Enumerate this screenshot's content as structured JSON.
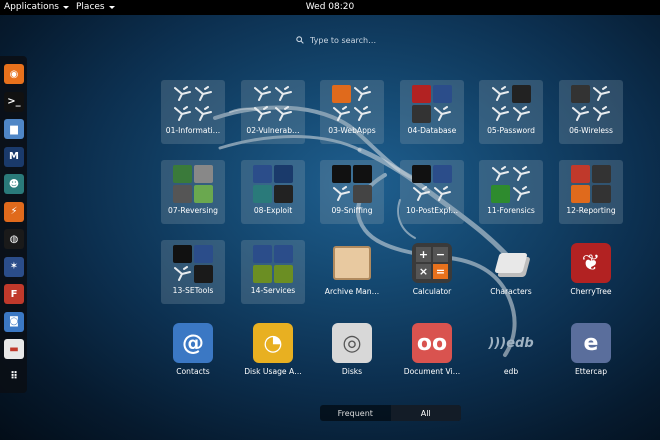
{
  "topbar": {
    "applications": "Applications",
    "places": "Places",
    "clock": "Wed 08:20"
  },
  "search": {
    "placeholder": "Type to search…"
  },
  "dock": [
    {
      "name": "firefox",
      "glyph": "◉",
      "bg": "#e8711c"
    },
    {
      "name": "terminal",
      "glyph": ">_",
      "bg": "#111111"
    },
    {
      "name": "files",
      "glyph": "▆",
      "bg": "#4f86c6"
    },
    {
      "name": "metasploit",
      "glyph": "M",
      "bg": "#1a3a6b"
    },
    {
      "name": "armitage",
      "glyph": "☻",
      "bg": "#2a7a7a"
    },
    {
      "name": "burpsuite",
      "glyph": "⚡",
      "bg": "#e06a1c"
    },
    {
      "name": "maltego",
      "glyph": "◍",
      "bg": "#1a1a1a"
    },
    {
      "name": "beef",
      "glyph": "✶",
      "bg": "#2b4d8a"
    },
    {
      "name": "faraday",
      "glyph": "F",
      "bg": "#c0392b"
    },
    {
      "name": "screenshot",
      "glyph": "◙",
      "bg": "#3b78c4"
    },
    {
      "name": "toggle-app",
      "glyph": "▬",
      "bg": "#e8e8e8"
    },
    {
      "name": "show-apps",
      "glyph": "⠿",
      "bg": "transparent"
    }
  ],
  "folders": [
    {
      "label": "01-Informati…",
      "minis": [
        "w",
        "w",
        "w",
        "w"
      ]
    },
    {
      "label": "02-Vulnerab…",
      "minis": [
        "w",
        "w",
        "w",
        "w"
      ]
    },
    {
      "label": "03-WebApps",
      "minis": [
        "#e06a1c",
        "w",
        "w",
        "w"
      ]
    },
    {
      "label": "04-Database",
      "minis": [
        "#b22222",
        "#2b4d8a",
        "#333333",
        "w"
      ]
    },
    {
      "label": "05-Password",
      "minis": [
        "w",
        "#222222",
        "w",
        "w"
      ]
    },
    {
      "label": "06-Wireless",
      "minis": [
        "#333333",
        "w",
        "w",
        "w"
      ]
    },
    {
      "label": "07-Reversing",
      "minis": [
        "#3a7a3a",
        "#888888",
        "#555555",
        "#6aa84f"
      ]
    },
    {
      "label": "08-Exploit",
      "minis": [
        "#2b4d8a",
        "#1a3a6b",
        "#2a7a7a",
        "#222222"
      ]
    },
    {
      "label": "09-Sniffing",
      "minis": [
        "#111111",
        "#111111",
        "w",
        "#444444"
      ]
    },
    {
      "label": "10-PostExpl…",
      "minis": [
        "#111111",
        "#2b4d8a",
        "w",
        "w"
      ]
    },
    {
      "label": "11-Forensics",
      "minis": [
        "w",
        "w",
        "#2e8b2e",
        "w"
      ]
    },
    {
      "label": "12-Reporting",
      "minis": [
        "#c0392b",
        "#333333",
        "#e06a1c",
        "#333333"
      ]
    },
    {
      "label": "13-SETools",
      "minis": [
        "#111111",
        "#2b4d8a",
        "w",
        "#1a1a1a"
      ]
    },
    {
      "label": "14-Services",
      "minis": [
        "#2b4d8a",
        "#2b4d8a",
        "#6b8e23",
        "#6b8e23"
      ]
    }
  ],
  "apps": [
    {
      "label": "Archive Man…",
      "glyph": "",
      "bg": "#d9b48a"
    },
    {
      "label": "Calculator",
      "glyph": "+ −\n× =",
      "bg": "#3a3a3a"
    },
    {
      "label": "Characters",
      "glyph": "▤",
      "bg": "transparent"
    },
    {
      "label": "CherryTree",
      "glyph": "❦",
      "bg": "#b22222"
    },
    {
      "label": "Contacts",
      "glyph": "@",
      "bg": "#3b78c4"
    },
    {
      "label": "Disk Usage A…",
      "glyph": "◔",
      "bg": "#e8b021"
    },
    {
      "label": "Disks",
      "glyph": "◎",
      "bg": "#d8d8d8"
    },
    {
      "label": "Document Vi…",
      "glyph": "oo",
      "bg": "#d9534f"
    },
    {
      "label": "edb",
      "glyph": "edb",
      "bg": "transparent"
    },
    {
      "label": "Ettercap",
      "glyph": "e",
      "bg": "#5a6e9c"
    }
  ],
  "tabs": [
    {
      "label": "Frequent",
      "active": false
    },
    {
      "label": "All",
      "active": true
    }
  ]
}
